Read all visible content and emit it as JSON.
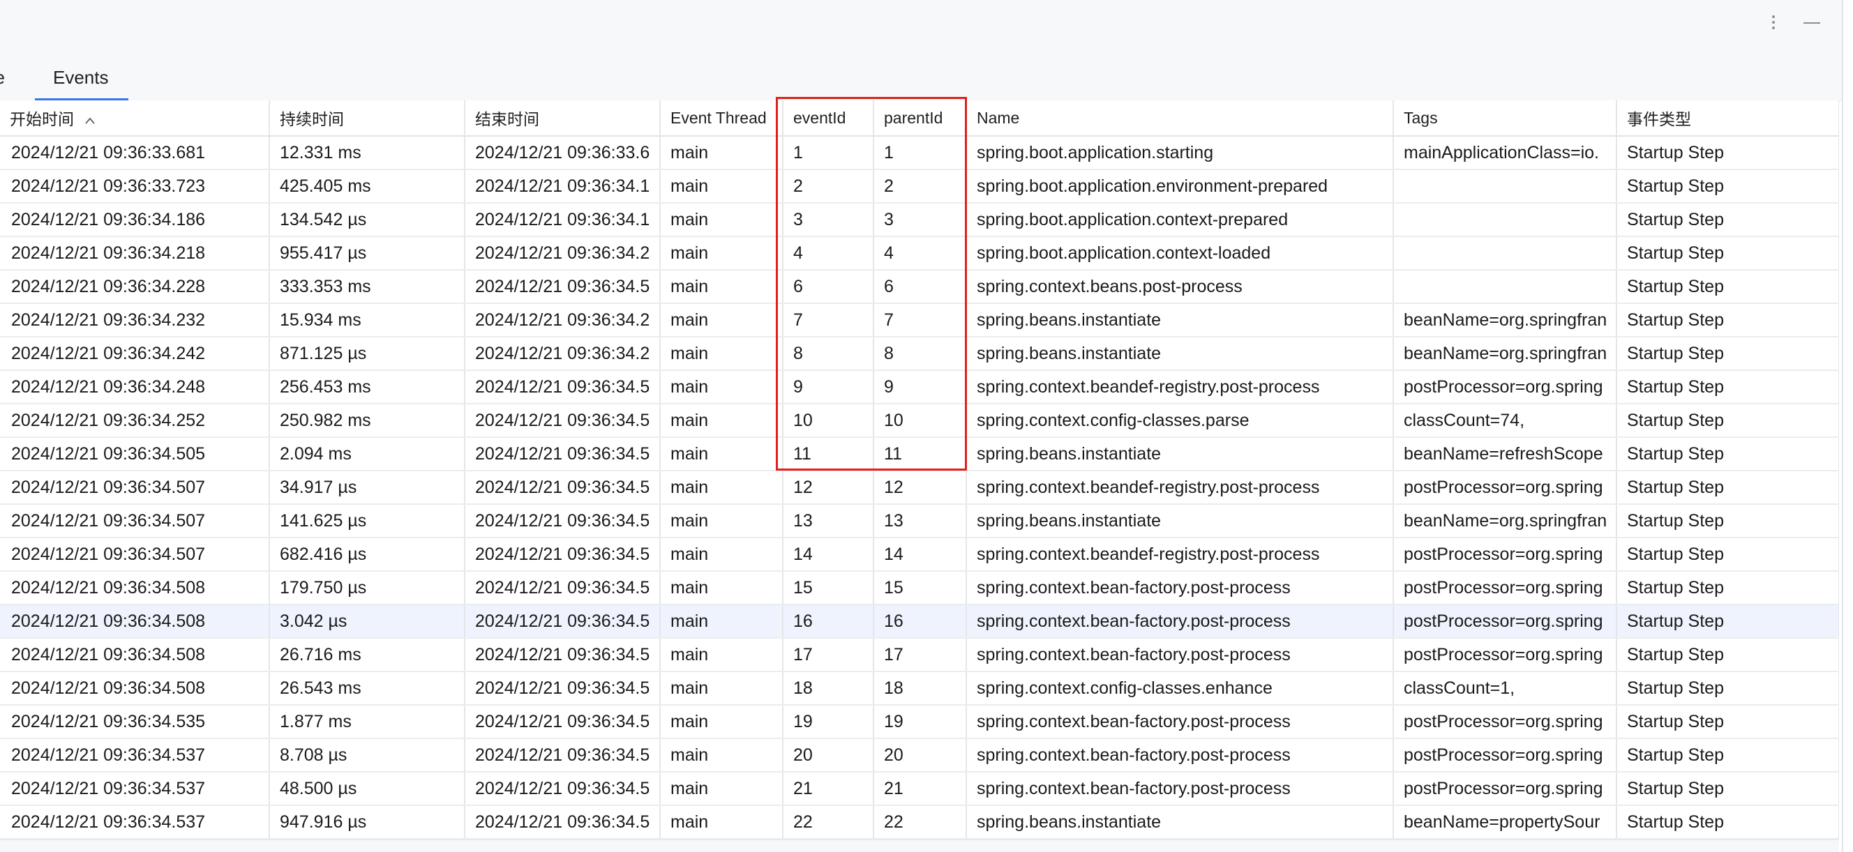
{
  "tabs": [
    {
      "label": "ne"
    },
    {
      "label": "Events"
    }
  ],
  "columns": [
    "开始时间",
    "持续时间",
    "结束时间",
    "Event Thread",
    "eventId",
    "parentId",
    "Name",
    "Tags",
    "事件类型"
  ],
  "rows": [
    [
      "2024/12/21 09:36:33.681",
      "12.331 ms",
      "2024/12/21 09:36:33.6",
      "main",
      "1",
      "1",
      "spring.boot.application.starting",
      "mainApplicationClass=io.",
      "Startup Step"
    ],
    [
      "2024/12/21 09:36:33.723",
      "425.405 ms",
      "2024/12/21 09:36:34.1",
      "main",
      "2",
      "2",
      "spring.boot.application.environment-prepared",
      "",
      "Startup Step"
    ],
    [
      "2024/12/21 09:36:34.186",
      "134.542 µs",
      "2024/12/21 09:36:34.1",
      "main",
      "3",
      "3",
      "spring.boot.application.context-prepared",
      "",
      "Startup Step"
    ],
    [
      "2024/12/21 09:36:34.218",
      "955.417 µs",
      "2024/12/21 09:36:34.2",
      "main",
      "4",
      "4",
      "spring.boot.application.context-loaded",
      "",
      "Startup Step"
    ],
    [
      "2024/12/21 09:36:34.228",
      "333.353 ms",
      "2024/12/21 09:36:34.5",
      "main",
      "6",
      "6",
      "spring.context.beans.post-process",
      "",
      "Startup Step"
    ],
    [
      "2024/12/21 09:36:34.232",
      "15.934 ms",
      "2024/12/21 09:36:34.2",
      "main",
      "7",
      "7",
      "spring.beans.instantiate",
      "beanName=org.springfran",
      "Startup Step"
    ],
    [
      "2024/12/21 09:36:34.242",
      "871.125 µs",
      "2024/12/21 09:36:34.2",
      "main",
      "8",
      "8",
      "spring.beans.instantiate",
      "beanName=org.springfran",
      "Startup Step"
    ],
    [
      "2024/12/21 09:36:34.248",
      "256.453 ms",
      "2024/12/21 09:36:34.5",
      "main",
      "9",
      "9",
      "spring.context.beandef-registry.post-process",
      "postProcessor=org.spring",
      "Startup Step"
    ],
    [
      "2024/12/21 09:36:34.252",
      "250.982 ms",
      "2024/12/21 09:36:34.5",
      "main",
      "10",
      "10",
      "spring.context.config-classes.parse",
      "classCount=74,",
      "Startup Step"
    ],
    [
      "2024/12/21 09:36:34.505",
      "2.094 ms",
      "2024/12/21 09:36:34.5",
      "main",
      "11",
      "11",
      "spring.beans.instantiate",
      "beanName=refreshScope",
      "Startup Step"
    ],
    [
      "2024/12/21 09:36:34.507",
      "34.917 µs",
      "2024/12/21 09:36:34.5",
      "main",
      "12",
      "12",
      "spring.context.beandef-registry.post-process",
      "postProcessor=org.spring",
      "Startup Step"
    ],
    [
      "2024/12/21 09:36:34.507",
      "141.625 µs",
      "2024/12/21 09:36:34.5",
      "main",
      "13",
      "13",
      "spring.beans.instantiate",
      "beanName=org.springfran",
      "Startup Step"
    ],
    [
      "2024/12/21 09:36:34.507",
      "682.416 µs",
      "2024/12/21 09:36:34.5",
      "main",
      "14",
      "14",
      "spring.context.beandef-registry.post-process",
      "postProcessor=org.spring",
      "Startup Step"
    ],
    [
      "2024/12/21 09:36:34.508",
      "179.750 µs",
      "2024/12/21 09:36:34.5",
      "main",
      "15",
      "15",
      "spring.context.bean-factory.post-process",
      "postProcessor=org.spring",
      "Startup Step"
    ],
    [
      "2024/12/21 09:36:34.508",
      "3.042 µs",
      "2024/12/21 09:36:34.5",
      "main",
      "16",
      "16",
      "spring.context.bean-factory.post-process",
      "postProcessor=org.spring",
      "Startup Step"
    ],
    [
      "2024/12/21 09:36:34.508",
      "26.716 ms",
      "2024/12/21 09:36:34.5",
      "main",
      "17",
      "17",
      "spring.context.bean-factory.post-process",
      "postProcessor=org.spring",
      "Startup Step"
    ],
    [
      "2024/12/21 09:36:34.508",
      "26.543 ms",
      "2024/12/21 09:36:34.5",
      "main",
      "18",
      "18",
      "spring.context.config-classes.enhance",
      "classCount=1,",
      "Startup Step"
    ],
    [
      "2024/12/21 09:36:34.535",
      "1.877 ms",
      "2024/12/21 09:36:34.5",
      "main",
      "19",
      "19",
      "spring.context.bean-factory.post-process",
      "postProcessor=org.spring",
      "Startup Step"
    ],
    [
      "2024/12/21 09:36:34.537",
      "8.708 µs",
      "2024/12/21 09:36:34.5",
      "main",
      "20",
      "20",
      "spring.context.bean-factory.post-process",
      "postProcessor=org.spring",
      "Startup Step"
    ],
    [
      "2024/12/21 09:36:34.537",
      "48.500 µs",
      "2024/12/21 09:36:34.5",
      "main",
      "21",
      "21",
      "spring.context.bean-factory.post-process",
      "postProcessor=org.spring",
      "Startup Step"
    ],
    [
      "2024/12/21 09:36:34.537",
      "947.916 µs",
      "2024/12/21 09:36:34.5",
      "main",
      "22",
      "22",
      "spring.beans.instantiate",
      "beanName=propertySour",
      "Startup Step"
    ]
  ],
  "sort": {
    "column_index": 0,
    "direction": "ascending"
  },
  "selected_row_index": 14,
  "colors": {
    "accent": "#3574f0",
    "highlight_box": "#e0201d",
    "selected_row": "#eef3fd"
  },
  "icons": {
    "more": "kebab-icon",
    "minimize": "minimize-icon",
    "sort": "sort-ascending-icon"
  }
}
